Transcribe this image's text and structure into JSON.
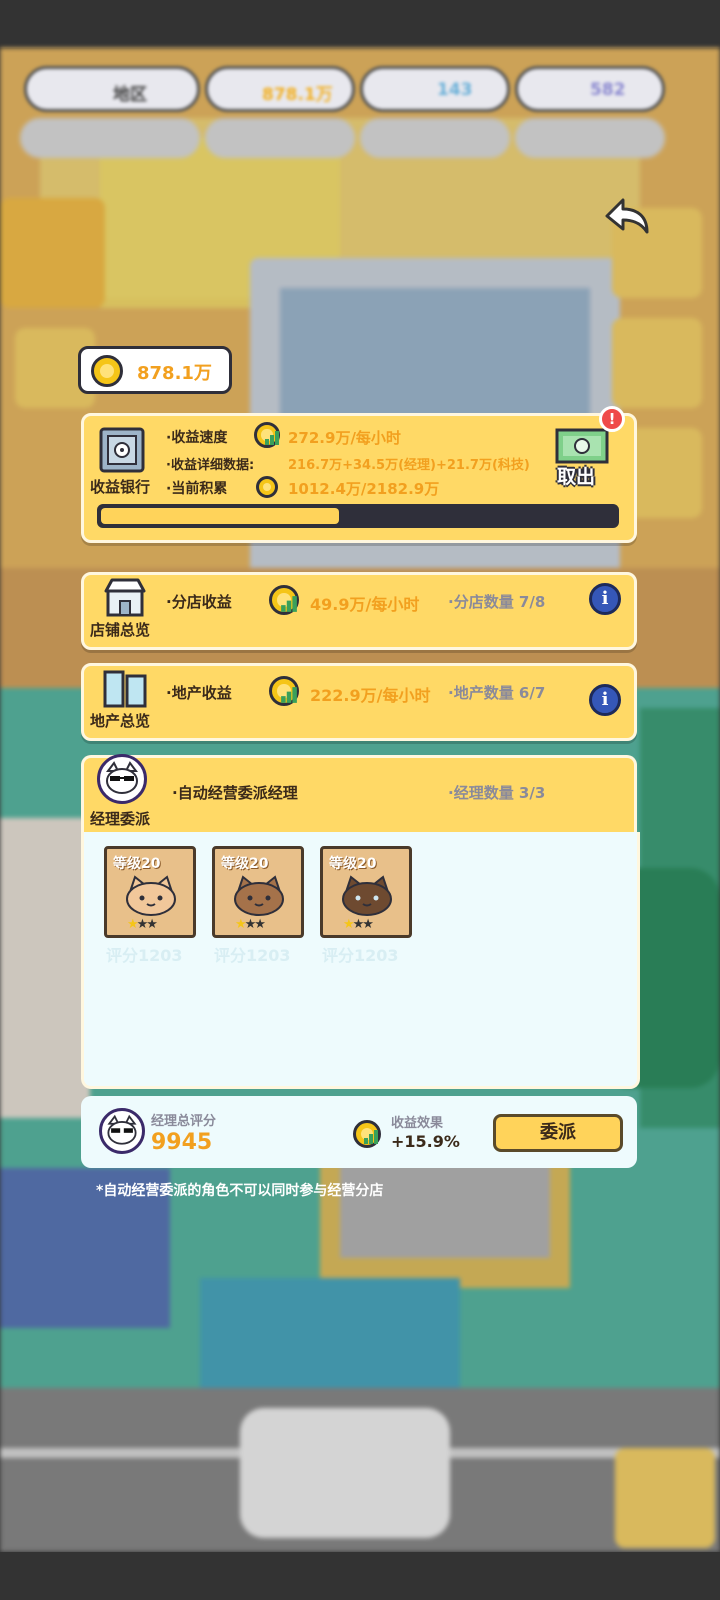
{
  "hud": {
    "district_label": "地区",
    "gold_value": "878.1万",
    "gem_value": "143",
    "token_value": "582"
  },
  "coin_display": {
    "value": "878.1万"
  },
  "bank": {
    "title": "收益银行",
    "speed_label": "·收益速度",
    "speed_value": "272.9万/每小时",
    "detail_label": "·收益详细数据:",
    "detail_value": "216.7万+34.5万(经理)+21.7万(科技)",
    "accum_label": "·当前积累",
    "accum_value": "1012.4万/2182.9万",
    "withdraw_label": "取出",
    "progress": 0.464
  },
  "shops": {
    "title": "店铺总览",
    "income_label": "·分店收益",
    "income_value": "49.9万/每小时",
    "count_label": "·分店数量 7/8"
  },
  "estate": {
    "title": "地产总览",
    "income_label": "·地产收益",
    "income_value": "222.9万/每小时",
    "count_label": "·地产数量 6/7"
  },
  "manager": {
    "title": "经理委派",
    "desc": "·自动经营委派经理",
    "count_label": "·经理数量  3/3",
    "slots": [
      {
        "level": "等级20",
        "score": "评分1203",
        "color": "#f1c79a",
        "stars": 1
      },
      {
        "level": "等级20",
        "score": "评分1203",
        "color": "#a5724a",
        "stars": 1
      },
      {
        "level": "等级20",
        "score": "评分1203",
        "color": "#6e4a30",
        "stars": 1
      }
    ],
    "total_label": "经理总评分",
    "total_value": "9945",
    "effect_label": "收益效果",
    "effect_value": "+15.9%",
    "assign_button": "委派",
    "note": "*自动经营委派的角色不可以同时参与经营分店"
  },
  "colors": {
    "accent": "#f2a01f",
    "panel": "#ffd966",
    "info": "#3557b8",
    "progress": "#ffd35a"
  }
}
